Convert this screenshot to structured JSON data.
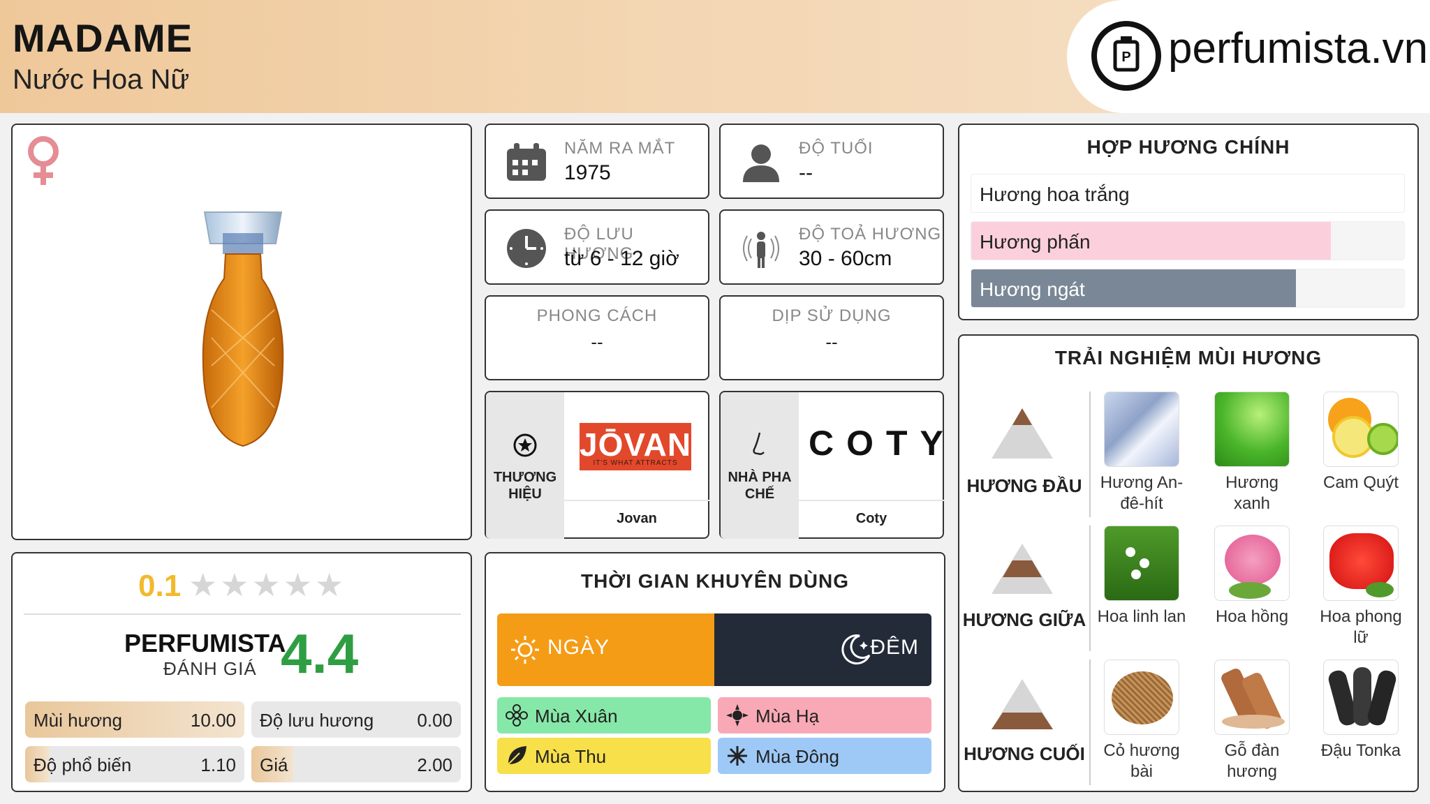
{
  "header": {
    "title": "MADAME",
    "subtitle": "Nước Hoa Nữ",
    "logo_text": "perfumista.vn",
    "logo_icon": "perfume-bottle-icon"
  },
  "product": {
    "gender_icon": "female-symbol-icon"
  },
  "rating": {
    "user_score": "0.1",
    "stars_total": 5,
    "user_rating_fraction": 0.02,
    "perfumista_label": "PERFUMISTA",
    "perfumista_sub": "ĐÁNH GIÁ",
    "perfumista_score": "4.4",
    "metrics": [
      {
        "label": "Mùi hương",
        "value": "10.00",
        "fill": 1.0
      },
      {
        "label": "Độ lưu hương",
        "value": "0.00",
        "fill": 0.0
      },
      {
        "label": "Độ phổ biến",
        "value": "1.10",
        "fill": 0.11
      },
      {
        "label": "Giá",
        "value": "2.00",
        "fill": 0.2
      }
    ]
  },
  "info": {
    "year": {
      "label": "NĂM RA MẮT",
      "value": "1975",
      "icon": "calendar-icon"
    },
    "age": {
      "label": "ĐỘ TUỔI",
      "value": "--",
      "icon": "user-icon"
    },
    "longevity": {
      "label": "ĐỘ LƯU HƯƠNG",
      "value": "từ 6 - 12 giờ",
      "icon": "clock-icon"
    },
    "sillage": {
      "label": "ĐỘ TOẢ HƯƠNG",
      "value": "30 - 60cm",
      "icon": "person-waves-icon"
    },
    "style": {
      "label": "PHONG CÁCH",
      "value": "--"
    },
    "occasion": {
      "label": "DỊP SỬ DỤNG",
      "value": "--"
    }
  },
  "brand": {
    "label_line1": "THƯƠNG",
    "label_line2": "HIỆU",
    "logo_text": "JŌVAN",
    "logo_tagline": "IT'S WHAT ATTRACTS",
    "name": "Jovan"
  },
  "perfumer": {
    "label_line1": "NHÀ PHA",
    "label_line2": "CHẾ",
    "logo_text": "COTY",
    "name": "Coty"
  },
  "time": {
    "title": "THỜI GIAN KHUYÊN DÙNG",
    "day": "NGÀY",
    "night": "ĐÊM",
    "seasons": [
      {
        "label": "Mùa Xuân",
        "color": "#86e8a8",
        "icon": "flower-icon"
      },
      {
        "label": "Mùa Hạ",
        "color": "#f9a9b6",
        "icon": "sun-icon"
      },
      {
        "label": "Mùa Thu",
        "color": "#f7e04a",
        "icon": "leaf-icon"
      },
      {
        "label": "Mùa Đông",
        "color": "#9ec9f7",
        "icon": "snowflake-icon"
      }
    ]
  },
  "accords": {
    "title": "HỢP HƯƠNG CHÍNH",
    "items": [
      {
        "label": "Hương hoa trắng",
        "fill": 1.0,
        "color": "#ffffff"
      },
      {
        "label": "Hương phấn",
        "fill": 0.83,
        "color": "#fbd0dc"
      },
      {
        "label": "Hương ngát",
        "fill": 0.75,
        "color": "#7a8796"
      }
    ]
  },
  "notes": {
    "title": "TRẢI NGHIỆM MÙI HƯƠNG",
    "tiers": [
      {
        "label": "HƯƠNG ĐẦU",
        "items": [
          "Hương An-đê-hít",
          "Hương xanh",
          "Cam Quýt"
        ]
      },
      {
        "label": "HƯƠNG GIỮA",
        "items": [
          "Hoa linh lan",
          "Hoa hồng",
          "Hoa phong lữ"
        ]
      },
      {
        "label": "HƯƠNG CUỐI",
        "items": [
          "Cỏ hương bài",
          "Gỗ đàn hương",
          "Đậu Tonka"
        ]
      }
    ]
  }
}
